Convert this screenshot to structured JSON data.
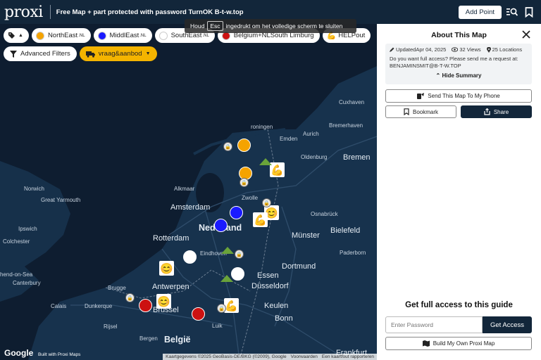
{
  "header": {
    "logo": "proxi",
    "title": "Free Map + part protected with password TurnOK B-t-w.top",
    "add_point": "Add Point"
  },
  "escape_hint": {
    "before": "Houd",
    "key": "Esc",
    "after": "ingedrukt om het volledige scherm te sluiten"
  },
  "chips": [
    {
      "label": "NorthEast",
      "suffix": ".NL",
      "color": "#f5a300"
    },
    {
      "label": "MiddlEast",
      "suffix": ".NL",
      "color": "#1a1aff"
    },
    {
      "label": "SouthEast",
      "suffix": ".NL",
      "color": "#ffffff"
    },
    {
      "label": "Belgium+NLSouth Limburg",
      "color": "#cc1111"
    },
    {
      "label": "HELPout"
    }
  ],
  "advanced_filters": "Advanced Filters",
  "category_chip": "vraag&aanbod",
  "map": {
    "places": [
      "Norwich",
      "Great Yarmouth",
      "Ipswich",
      "Colchester",
      "hend-on-Sea",
      "Canterbury",
      "Calais",
      "Dunkerque",
      "Brugge",
      "Antwerpen",
      "Brussel",
      "Rijsel",
      "Bergen",
      "België",
      "Rotterdam",
      "Eindhoven",
      "Amsterdam",
      "Alkmaar",
      "Nederland",
      "Zwolle",
      "roningen",
      "Aurich",
      "Emden",
      "Oldenburg",
      "Bremen",
      "Bremerhaven",
      "Cuxhaven",
      "Osnabrück",
      "Münster",
      "Bielefeld",
      "Paderborn",
      "Dortmund",
      "Essen",
      "Düsseldorf",
      "Keulen",
      "Bonn",
      "Luik",
      "Frankfurt"
    ],
    "google": "Google",
    "built_with": "Built with Proxi Maps",
    "attribution": [
      "Kaartgegevens ©2025 GeoBasis-DE/BKG (©2009), Google",
      "Voorwaarden",
      "Een kaartfout rapporteren"
    ]
  },
  "panel": {
    "title": "About This Map",
    "updated": "UpdatedApr 04, 2025",
    "views": "32 Views",
    "locations": "25 Locations",
    "description": "Do you want full access? Please send me a request at: BENJAMINSMIT@B-T-W.TOP",
    "hide_summary": "Hide Summary",
    "send_phone": "Send This Map To My Phone",
    "bookmark": "Bookmark",
    "share": "Share",
    "access_title": "Get full access to this guide",
    "password_placeholder": "Enter Password",
    "get_access": "Get Access",
    "build_map": "Build My Own Proxi Map"
  }
}
